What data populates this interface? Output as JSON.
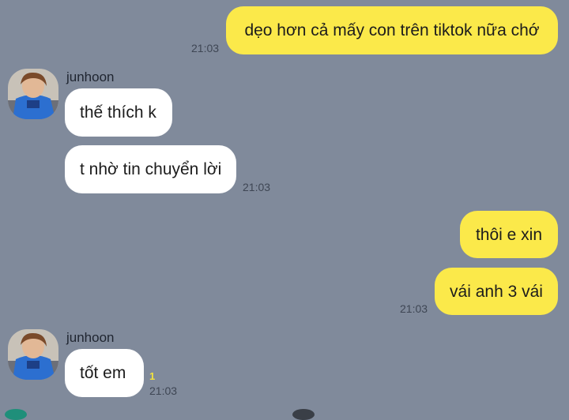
{
  "messages": [
    {
      "text": "dẹo hơn cả mấy con trên tiktok nữa chớ",
      "time": "21:03"
    },
    {
      "sender": "junhoon",
      "text": "thế thích k"
    },
    {
      "text": "t nhờ tin chuyển lời",
      "time": "21:03"
    },
    {
      "text": "thôi e xin"
    },
    {
      "text": "vái anh 3 vái",
      "time": "21:03"
    },
    {
      "sender": "junhoon",
      "text": "tốt em",
      "unread": "1",
      "time": "21:03"
    }
  ],
  "colors": {
    "background": "#808a9b",
    "outgoing_bubble": "#fbe94a",
    "incoming_bubble": "#ffffff",
    "unread_count": "#f2e23e"
  },
  "icons": {
    "avatar": "profile-photo"
  }
}
